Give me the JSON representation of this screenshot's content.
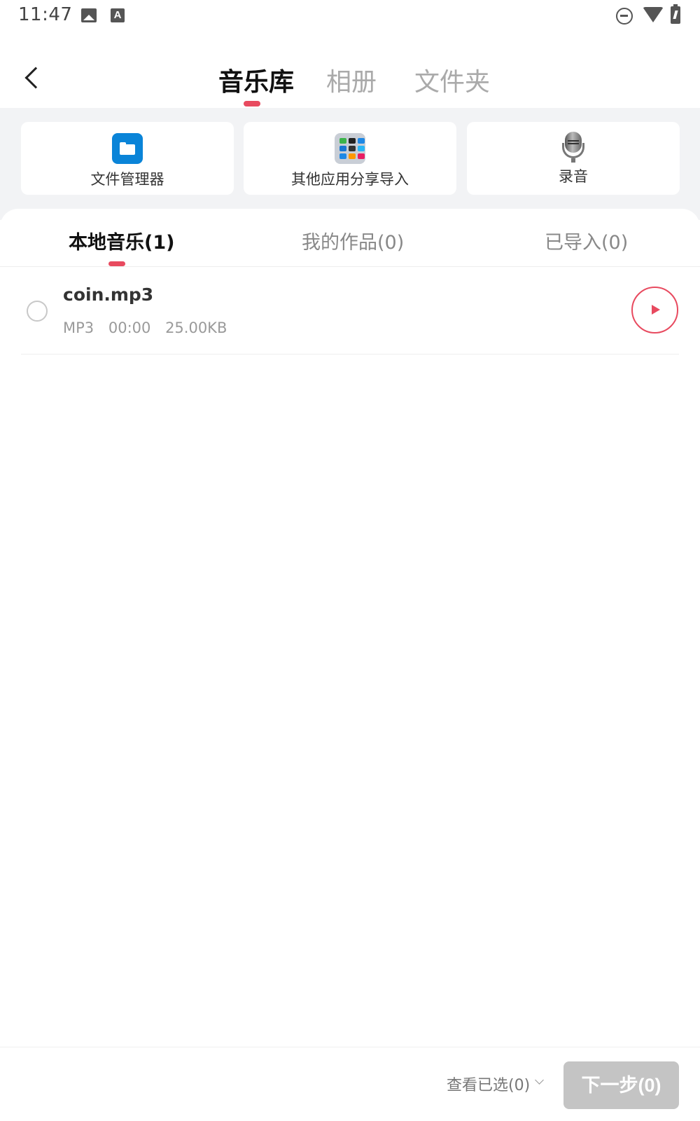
{
  "status_bar": {
    "time": "11:47"
  },
  "header": {
    "tabs": [
      {
        "label": "音乐库",
        "active": true
      },
      {
        "label": "相册",
        "active": false
      },
      {
        "label": "文件夹",
        "active": false
      }
    ]
  },
  "sources": [
    {
      "label": "文件管理器",
      "icon": "folder-icon"
    },
    {
      "label": "其他应用分享导入",
      "icon": "apps-grid-icon"
    },
    {
      "label": "录音",
      "icon": "microphone-icon"
    }
  ],
  "sub_tabs": [
    {
      "label": "本地音乐(1)",
      "active": true
    },
    {
      "label": "我的作品(0)",
      "active": false
    },
    {
      "label": "已导入(0)",
      "active": false
    }
  ],
  "files": [
    {
      "name": "coin.mp3",
      "format": "MP3",
      "duration": "00:00",
      "size": "25.00KB",
      "selected": false
    }
  ],
  "bottom_bar": {
    "view_selected": "查看已选(0)",
    "next": "下一步(0)"
  },
  "colors": {
    "accent": "#e84a5f",
    "background_band": "#f2f3f5",
    "disabled_button": "#c4c4c4",
    "folder_blue": "#0a84d8"
  }
}
